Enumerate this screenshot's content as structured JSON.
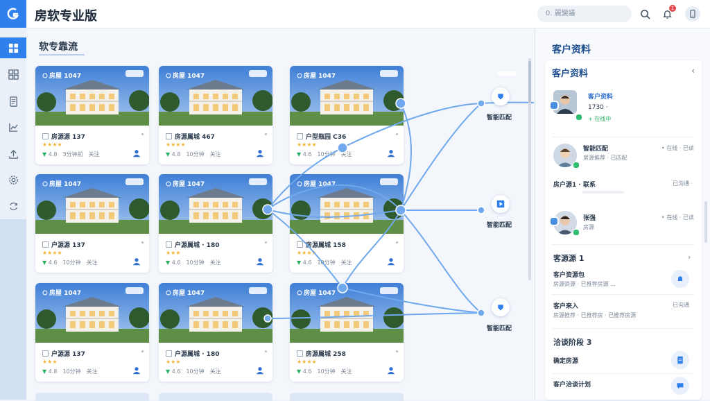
{
  "app": {
    "title": "房软专业版"
  },
  "header": {
    "search_placeholder": "0. 麗變議",
    "notification_count": "1"
  },
  "main": {
    "section_title": "软专靠流",
    "cards": [
      {
        "code": "房屋 1047",
        "name": "房源源 137",
        "stars": "★★★★",
        "score": "4.8",
        "time": "3分钟前",
        "status": "关注"
      },
      {
        "code": "房屋 1047",
        "name": "房源属城 467",
        "stars": "★★★★",
        "score": "4.8",
        "time": "10分钟",
        "status": "关注"
      },
      {
        "code": "房屋 1047",
        "name": "户型瓶园 C36",
        "stars": "★★★★",
        "score": "4.6",
        "time": "10分钟",
        "status": "关注"
      },
      {
        "code": "房屋 1047",
        "name": "户源源 137",
        "stars": "★★★★",
        "score": "4.6",
        "time": "10分钟",
        "status": "关注"
      },
      {
        "code": "房屋 1047",
        "name": "户源属城 · 180",
        "stars": "★★★",
        "score": "4.6",
        "time": "10分钟",
        "status": "关注"
      },
      {
        "code": "房屋 1047",
        "name": "房源属城 158",
        "stars": "★★★★",
        "score": "4.6",
        "time": "10分钟",
        "status": "关注"
      },
      {
        "code": "房屋 1047",
        "name": "户源源 137",
        "stars": "★★★",
        "score": "4.8",
        "time": "10分钟",
        "status": "关注"
      },
      {
        "code": "房屋 1047",
        "name": "户源属城 · 180",
        "stars": "★★★",
        "score": "4.6",
        "time": "10分钟",
        "status": "关注"
      },
      {
        "code": "房屋 1047",
        "name": "房源属城 258",
        "stars": "★★★★",
        "score": "4.6",
        "time": "10分钟",
        "status": "关注"
      }
    ]
  },
  "flow": {
    "nodes": [
      {
        "label": "智能匹配"
      },
      {
        "label": "智能匹配"
      },
      {
        "label": "智能匹配"
      }
    ]
  },
  "panel": {
    "header": "客户资料",
    "card_title": "客户资料",
    "primary": {
      "name": "客户资料",
      "id": "1730 ·",
      "tag": "+ 在线中"
    },
    "contacts": [
      {
        "name": "智能匹配",
        "sub": "房源推荐 · 已匹配",
        "right": "• 在线 · 已读"
      },
      {
        "name": "房户源1 · 联系",
        "sub": "",
        "right": "已沟通 ·"
      },
      {
        "name": "张强",
        "sub": "房源",
        "right": "• 在线 · 已读"
      }
    ],
    "section1": {
      "title": "客源源 1",
      "items": [
        {
          "name": "客户资源包",
          "sub": "房源资源 · 已推荐房源 ..."
        },
        {
          "name": "客户来入",
          "sub": "房源推荐 · 已推荐房 · 已推荐房源",
          "right": "已沟通"
        }
      ]
    },
    "section2": {
      "title": "洽谈阶段 3",
      "items": [
        {
          "name": "确定房源"
        },
        {
          "name": "客户洽谈计划"
        }
      ]
    }
  },
  "colors": {
    "accent": "#2f80ed",
    "flow_line": "#6fa8ec",
    "panel_title": "#1f4f8f"
  }
}
